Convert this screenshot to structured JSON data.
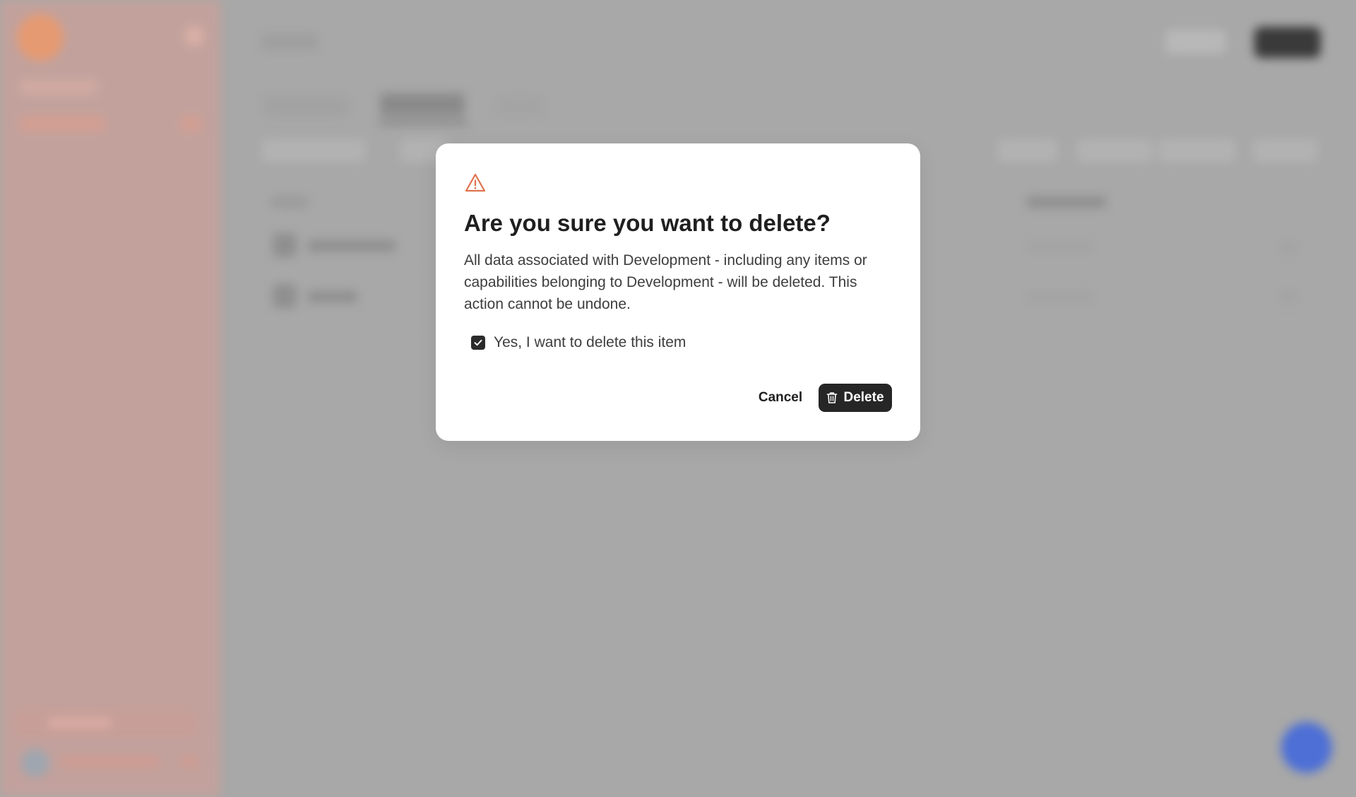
{
  "modal": {
    "icon": "warning-triangle-icon",
    "title": "Are you sure you want to delete?",
    "body": "All data associated with Development - including any items or capabilities belonging to Development - will be deleted. This action cannot be undone.",
    "confirm_checked": true,
    "confirm_label": "Yes, I want to delete this item",
    "cancel_label": "Cancel",
    "delete_label": "Delete",
    "delete_icon": "trash-icon"
  },
  "colors": {
    "accent_warning": "#e0734f",
    "button_dark": "#262626",
    "overlay": "#a8a8a8"
  }
}
